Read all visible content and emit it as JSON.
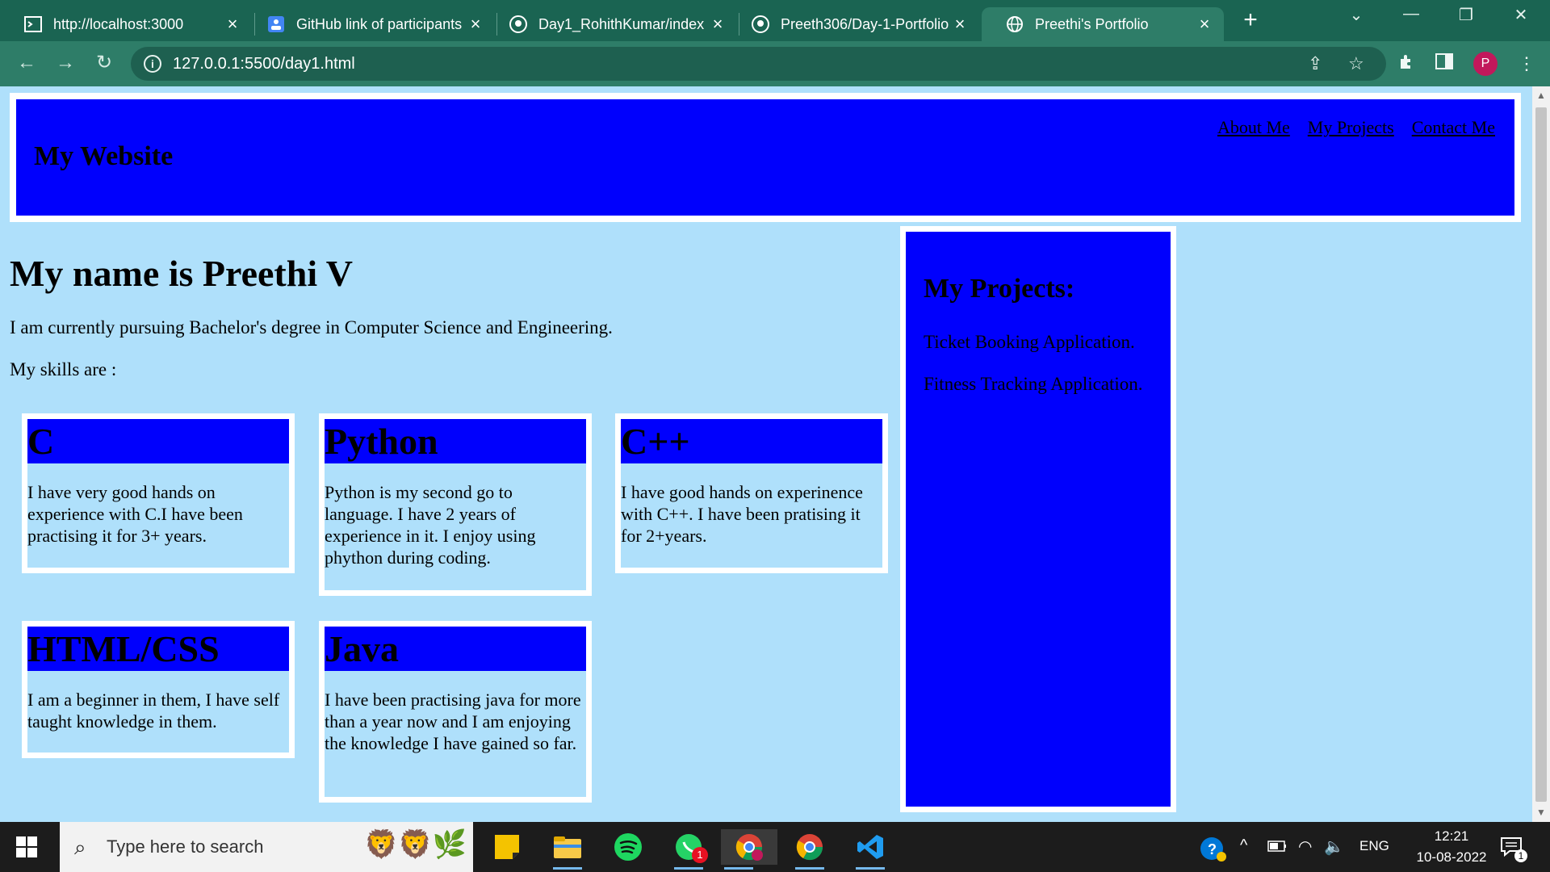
{
  "browser": {
    "tabs": [
      {
        "title": "http://localhost:3000",
        "active": false
      },
      {
        "title": "GitHub link of participants",
        "active": false
      },
      {
        "title": "Day1_RohithKumar/index",
        "active": false
      },
      {
        "title": "Preeth306/Day-1-Portfolio",
        "active": false
      },
      {
        "title": "Preethi's Portfolio",
        "active": true
      }
    ],
    "url": "127.0.0.1:5500/day1.html",
    "profile_initial": "P"
  },
  "page": {
    "site_title": "My Website",
    "nav": [
      "About Me",
      "My Projects",
      "Contact Me"
    ],
    "heading": "My name is Preethi V",
    "intro": "I am currently pursuing Bachelor's degree in Computer Science and Engineering.",
    "skills_label": "My skills are :",
    "skills": [
      {
        "name": "C",
        "text": "I have very good hands on experience with C.I have been practising it for 3+ years."
      },
      {
        "name": "Python",
        "text": "Python is my second go to language. I have 2 years of experience in it. I enjoy using phython during coding."
      },
      {
        "name": "C++",
        "text": "I have good hands on experinence with C++. I have been pratising it for 2+years."
      },
      {
        "name": "HTML/CSS",
        "text": "I am a beginner in them, I have self taught knowledge in them."
      },
      {
        "name": "Java",
        "text": "I have been practising java for more than a year now and I am enjoying the knowledge I have gained so far."
      }
    ],
    "projects_title": "My Projects:",
    "projects": [
      "Ticket Booking Application.",
      "Fitness Tracking Application."
    ]
  },
  "taskbar": {
    "search_placeholder": "Type here to search",
    "language": "ENG",
    "time": "12:21",
    "date": "10-08-2022",
    "whatsapp_badge": "1",
    "notification_count": "1"
  },
  "colors": {
    "page_bg": "#afe0fb",
    "block_blue": "#0000fd",
    "chrome_green": "#2e7d68"
  }
}
